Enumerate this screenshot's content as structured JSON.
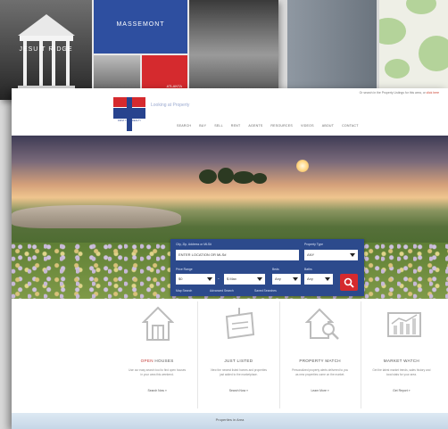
{
  "background": {
    "tile_left_caption": "JESUIT RIDGE",
    "tile_blue_caption": "MASSEMONT",
    "tile_red_caption": "ATLANTA"
  },
  "site": {
    "top_link_prefix": "Or search in the Property Listings for this area, or",
    "top_link": "click here",
    "logo_text": "FIRST TEAM REALTY",
    "tagline": "Looking at Property",
    "nav": [
      "SEARCH",
      "BUY",
      "SELL",
      "RENT",
      "AGENTS",
      "RESOURCES",
      "VIDEOS",
      "ABOUT",
      "CONTACT"
    ],
    "search": {
      "location_label": "City, Zip, Address or MLS#",
      "location_value": "ENTER LOCATION OR MLS#",
      "type_label": "Property Type",
      "type_value": "ANY",
      "price_label": "Price Range",
      "price_min": "$0",
      "price_max": "$ Max",
      "beds_label": "Beds",
      "beds_value": "Any",
      "baths_label": "Baths",
      "baths_value": "Any",
      "link_map": "Map Search",
      "link_advanced": "Advanced Search",
      "link_saved": "Saved Searches",
      "colors": {
        "panel": "#2c4a8c",
        "button": "#d52a2e"
      }
    },
    "features": [
      {
        "icon": "house-icon",
        "title_accent": "OPEN",
        "title_rest": " HOUSES",
        "desc": "Use our easy search tool to find open houses in your area this weekend.",
        "more": "Search Now »"
      },
      {
        "icon": "sign-icon",
        "title_accent": "",
        "title_rest": "JUST LISTED",
        "desc": "View the newest listed homes and properties just added to the marketplace.",
        "more": "Search Now »"
      },
      {
        "icon": "house-search-icon",
        "title_accent": "",
        "title_rest": "PROPERTY MATCH",
        "desc": "Personalized property alerts delivered to you as new properties come on the market.",
        "more": "Learn More »"
      },
      {
        "icon": "chart-icon",
        "title_accent": "",
        "title_rest": "MARKET WATCH",
        "desc": "Get the latest market trends, sales history and local stats for your area.",
        "more": "Get Report »"
      }
    ],
    "bottom_bar": "Properties in Area"
  }
}
